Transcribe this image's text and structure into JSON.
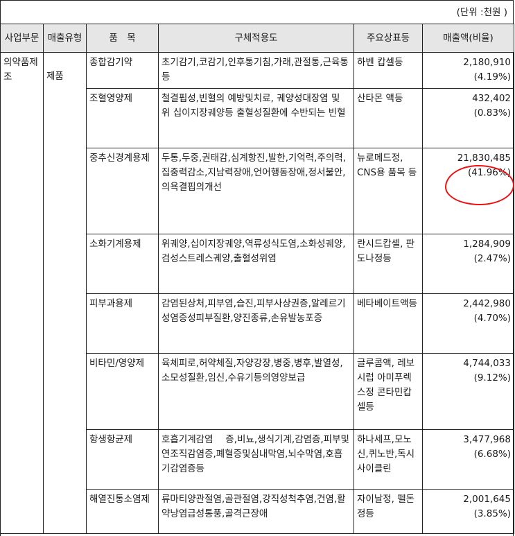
{
  "unit_label": "(단위 :천원 )",
  "headers": {
    "segment": "사업부문",
    "sales_type": "매출유형",
    "product": "품　목",
    "usage": "구체적용도",
    "brand": "주요상표등",
    "sales": "매출액(비율)"
  },
  "segment": "의약품제조",
  "sales_type": "제품",
  "rows": [
    {
      "product": "종합감기약",
      "usage": "초기감기,코감기,인후통기침,가래,관절통,근육통등",
      "brand": "하벤 캅셀등",
      "amount": "2,180,910",
      "ratio": "(4.19%)"
    },
    {
      "product": "조혈영양제",
      "usage": "철결핍성,빈혈의 예방및치료, 궤양성대장염 및 위 십이지장궤양등 출혈성질환에 수반되는 빈혈",
      "brand": "산타몬 액등",
      "amount": "432,402",
      "ratio": "(0.83%)"
    },
    {
      "product": "중추신경계용제",
      "usage": "두통,두중,권태감,심계항진,발한,기억력,주의력,집중력감소,지남력장애,언어행동장애,정서불안,의욕결핍의개선",
      "brand": "뉴로메드정, CNS용 품목 등",
      "amount": "21,830,485",
      "ratio": "(41.96%)"
    },
    {
      "product": "소화기계용제",
      "usage": "위궤양,십이지장궤양,역류성식도염,소화성궤양,검성스트레스궤양,출혈성위염",
      "brand": "란시드캅셀, 판도나정등",
      "amount": "1,284,909",
      "ratio": "(2.47%)"
    },
    {
      "product": "피부과용제",
      "usage": "감염된상처,피부염,습진,피부사상권증,알레르기성염증성피부질환,양진종류,손유발농포증",
      "brand": "베타베이트액등",
      "amount": "2,442,980",
      "ratio": "(4.70%)"
    },
    {
      "product": "비타민/영양제",
      "usage": "육체피로,허약체질,자양강장,병중,병후,발열성,소모성질환,임신,수유기등의영양보급",
      "brand": "글루콤액, 레보시럽 아미푸렉스정 콘타민캅셀등",
      "amount": "4,744,033",
      "ratio": "(9.12%)"
    },
    {
      "product": "항생항균제",
      "usage": "호흡기계감염　 증,비뇨,생식기계,감염증,피부및연조직감염증,폐혈증및심내막염,뇌수막염,호흡기감염증등",
      "brand": "하나세프,모노신,퀴노반,독시사이클린",
      "amount": "3,477,968",
      "ratio": "(6.68%)"
    },
    {
      "product": "해열진통소염제",
      "usage": "류마티양관절염,골관절염,강직성척추염,건염,활약낭염급성통풍,골격근장애",
      "brand": "자이날정, 펠돈정등",
      "amount": "2,001,645",
      "ratio": "(3.85%)"
    }
  ]
}
